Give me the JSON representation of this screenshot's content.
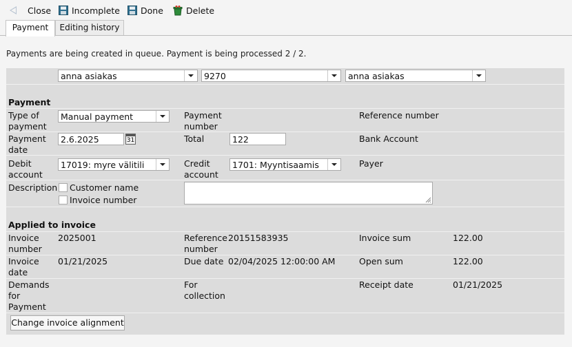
{
  "toolbar": {
    "close_label": "Close",
    "incomplete_label": "Incomplete",
    "done_label": "Done",
    "delete_label": "Delete"
  },
  "tabs": [
    {
      "label": "Payment"
    },
    {
      "label": "Editing history"
    }
  ],
  "queue_message": "Payments are being created in queue. Payment is being processed 2 / 2.",
  "top_selects": {
    "customer": "anna asiakas",
    "number": "9270",
    "customer2": "anna asiakas"
  },
  "payment": {
    "heading": "Payment",
    "type_label": "Type of payment",
    "type_label_l1": "Type of",
    "type_label_l2": "payment",
    "type_value": "Manual payment",
    "number_label_l1": "Payment",
    "number_label_l2": "number",
    "reference_label": "Reference number",
    "date_label_l1": "Payment",
    "date_label_l2": "date",
    "date_value": "2.6.2025",
    "calendar_day": "31",
    "total_label": "Total",
    "total_value": "122",
    "bank_account_label": "Bank Account",
    "debit_label_l1": "Debit",
    "debit_label_l2": "account",
    "debit_value": "17019: myre välitili",
    "credit_label_l1": "Credit",
    "credit_label_l2": "account",
    "credit_value": "1701: Myyntisaamis",
    "payer_label": "Payer",
    "description_label": "Description",
    "customer_name_label": "Customer name",
    "invoice_number_cb_label": "Invoice number",
    "description_value": ""
  },
  "applied": {
    "heading": "Applied to invoice",
    "invoice_number_l1": "Invoice",
    "invoice_number_l2": "number",
    "invoice_number_value": "2025001",
    "reference_l1": "Reference",
    "reference_l2": "number",
    "reference_value": "20151583935",
    "invoice_sum_label": "Invoice sum",
    "invoice_sum_value": "122.00",
    "invoice_date_l1": "Invoice",
    "invoice_date_l2": "date",
    "invoice_date_value": "01/21/2025",
    "due_date_label": "Due date",
    "due_date_value": "02/04/2025 12:00:00 AM",
    "open_sum_label": "Open sum",
    "open_sum_value": "122.00",
    "demands_l1": "Demands",
    "demands_l2": "for",
    "demands_l3": "Payment",
    "for_collection_l1": "For",
    "for_collection_l2": "collection",
    "receipt_date_label": "Receipt date",
    "receipt_date_value": "01/21/2025",
    "change_alignment_label": "Change invoice alignment"
  },
  "colors": {
    "panel": "#dcdcdc",
    "background": "#f4f4f4",
    "save_icon": "#2f6f8f",
    "delete_icon": "#2e8b3a"
  }
}
